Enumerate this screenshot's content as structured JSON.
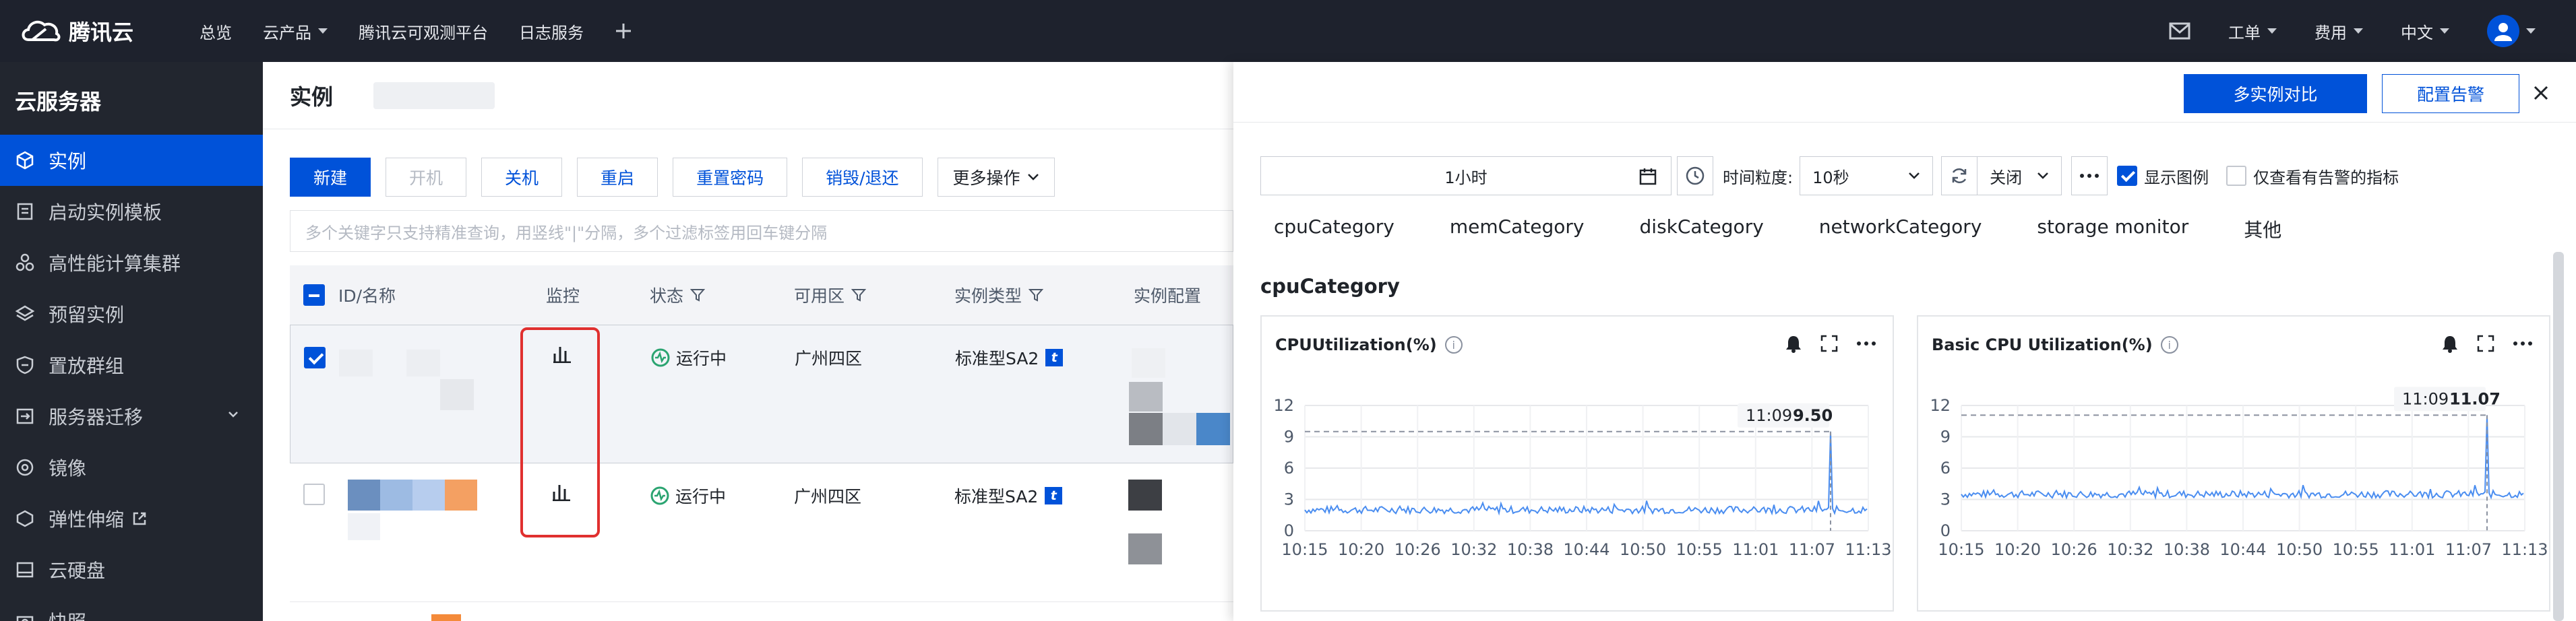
{
  "topnav": {
    "brand": "腾讯云",
    "items": [
      {
        "label": "总览",
        "dropdown": false
      },
      {
        "label": "云产品",
        "dropdown": true
      },
      {
        "label": "腾讯云可观测平台",
        "dropdown": false
      },
      {
        "label": "日志服务",
        "dropdown": false
      }
    ],
    "right": [
      {
        "label": "工单"
      },
      {
        "label": "费用"
      },
      {
        "label": "中文"
      }
    ]
  },
  "sidebar": {
    "title": "云服务器",
    "items": [
      {
        "label": "实例",
        "icon": "cube-icon",
        "active": true
      },
      {
        "label": "启动实例模板",
        "icon": "template-icon"
      },
      {
        "label": "高性能计算集群",
        "icon": "cluster-icon"
      },
      {
        "label": "预留实例",
        "icon": "layers-icon"
      },
      {
        "label": "置放群组",
        "icon": "shield-icon"
      },
      {
        "label": "服务器迁移",
        "icon": "migrate-icon",
        "expandable": true
      },
      {
        "label": "镜像",
        "icon": "disc-icon"
      },
      {
        "label": "弹性伸缩",
        "icon": "scale-icon",
        "external": true
      },
      {
        "label": "云硬盘",
        "icon": "disk-icon"
      },
      {
        "label": "快照",
        "icon": "camera-icon"
      }
    ]
  },
  "main": {
    "title": "实例",
    "toolbar": {
      "new": "新建",
      "start": "开机",
      "shutdown": "关机",
      "restart": "重启",
      "reset_password": "重置密码",
      "destroy": "销毁/退还",
      "more": "更多操作"
    },
    "search_placeholder": "多个关键字只支持精准查询，用竖线\"|\"分隔，多个过滤标签用回车键分隔",
    "columns": {
      "id": "ID/名称",
      "monitor": "监控",
      "status": "状态",
      "zone": "可用区",
      "type": "实例类型",
      "config": "实例配置"
    },
    "rows": [
      {
        "checked": true,
        "status": "运行中",
        "zone": "广州四区",
        "type": "标准型SA2",
        "type_badge": "t"
      },
      {
        "checked": false,
        "status": "运行中",
        "zone": "广州四区",
        "type": "标准型SA2",
        "type_badge": "t"
      }
    ]
  },
  "panel": {
    "compare_button": "多实例对比",
    "alarm_button": "配置告警",
    "time_range": "1小时",
    "granularity_label": "时间粒度:",
    "granularity_value": "10秒",
    "refresh_value": "关闭",
    "show_legend_label": "显示图例",
    "show_legend_checked": true,
    "alarm_only_label": "仅查看有告警的指标",
    "alarm_only_checked": false,
    "categories": [
      "cpuCategory",
      "memCategory",
      "diskCategory",
      "networkCategory",
      "storage monitor",
      "其他"
    ],
    "section_title": "cpuCategory"
  },
  "colors": {
    "brand_blue": "#0052d9",
    "line_blue": "#4a8df0",
    "highlight_red": "#e0302f",
    "nav_bg": "#1e222d",
    "sidebar_bg": "#22262f"
  },
  "chart_data": [
    {
      "type": "line",
      "title": "CPUUtilization(%)",
      "ylim": [
        0,
        12
      ],
      "yticks": [
        "12",
        "9",
        "6",
        "3",
        "0"
      ],
      "x_ticks": [
        "10:15",
        "10:20",
        "10:26",
        "10:32",
        "10:38",
        "10:44",
        "10:50",
        "10:55",
        "11:01",
        "11:07",
        "11:13"
      ],
      "baseline": 2.0,
      "noise": 0.35,
      "spike": {
        "x": "11:09",
        "value": 9.5
      },
      "tooltip_time": "11:09",
      "tooltip_value": "9.50",
      "grid": true
    },
    {
      "type": "line",
      "title": "Basic CPU Utilization(%)",
      "ylim": [
        0,
        12
      ],
      "yticks": [
        "12",
        "9",
        "6",
        "3",
        "0"
      ],
      "x_ticks": [
        "10:15",
        "10:20",
        "10:26",
        "10:32",
        "10:38",
        "10:44",
        "10:50",
        "10:55",
        "11:01",
        "11:07",
        "11:13"
      ],
      "baseline": 3.5,
      "noise": 0.35,
      "spike": {
        "x": "11:09",
        "value": 11.07
      },
      "tooltip_time": "11:09",
      "tooltip_value": "11.07",
      "grid": true
    }
  ]
}
